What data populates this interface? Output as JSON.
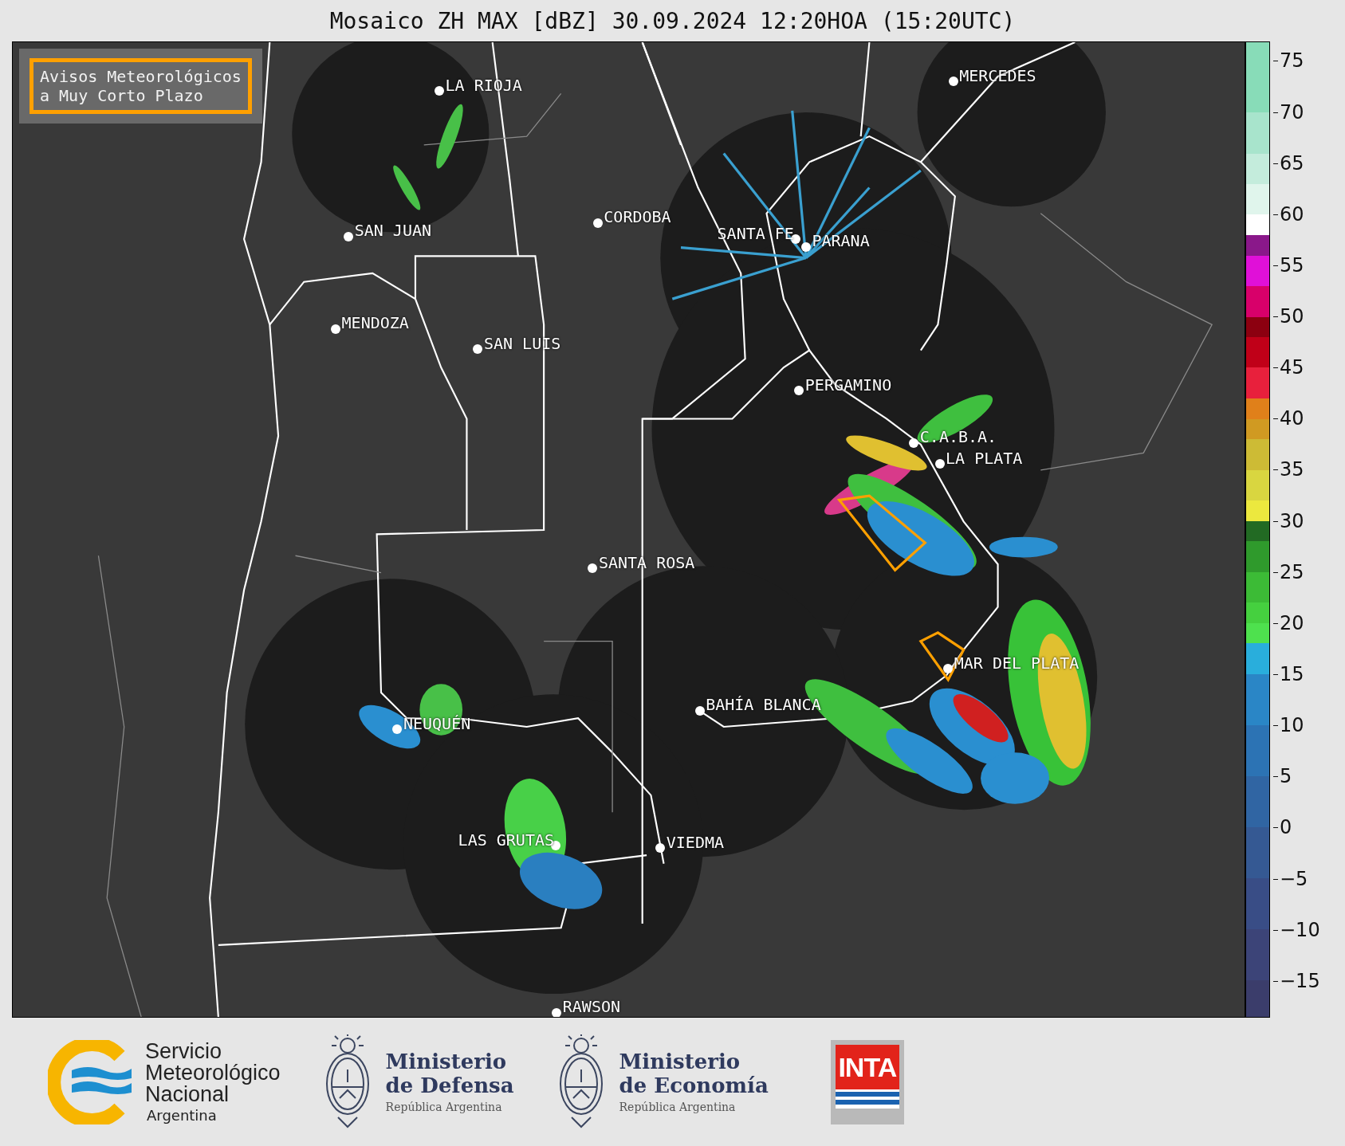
{
  "title": "Mosaico ZH MAX [dBZ] 30.09.2024 12:20HOA (15:20UTC)",
  "warning_legend": {
    "lines": [
      "Avisos Meteorológicos",
      "a Muy Corto Plazo"
    ]
  },
  "cities": [
    {
      "name": "LA RIOJA"
    },
    {
      "name": "MERCEDES"
    },
    {
      "name": "SAN JUAN"
    },
    {
      "name": "CORDOBA"
    },
    {
      "name": "SANTA FE"
    },
    {
      "name": "PARANA"
    },
    {
      "name": "MENDOZA"
    },
    {
      "name": "SAN LUIS"
    },
    {
      "name": "PERGAMINO"
    },
    {
      "name": "C.A.B.A."
    },
    {
      "name": "LA PLATA"
    },
    {
      "name": "SANTA ROSA"
    },
    {
      "name": "MAR DEL PLATA"
    },
    {
      "name": "BAHÍA BLANCA"
    },
    {
      "name": "NEUQUÉN"
    },
    {
      "name": "LAS GRUTAS"
    },
    {
      "name": "VIEDMA"
    },
    {
      "name": "RAWSON"
    }
  ],
  "colorbar": {
    "ticks": [
      "75",
      "70",
      "65",
      "60",
      "55",
      "50",
      "45",
      "40",
      "35",
      "30",
      "25",
      "20",
      "15",
      "10",
      "5",
      "0",
      "−5",
      "−10",
      "−15"
    ]
  },
  "logos": [
    {
      "kind": "smn",
      "lines": [
        "Servicio",
        "Meteorológico",
        "Nacional"
      ],
      "sub": "Argentina"
    },
    {
      "kind": "ministry",
      "lines": [
        "Ministerio",
        "de Defensa"
      ],
      "sub": "República Argentina"
    },
    {
      "kind": "ministry",
      "lines": [
        "Ministerio",
        "de Economía"
      ],
      "sub": "República Argentina"
    },
    {
      "kind": "inta",
      "lines": [
        "INTA"
      ]
    }
  ]
}
